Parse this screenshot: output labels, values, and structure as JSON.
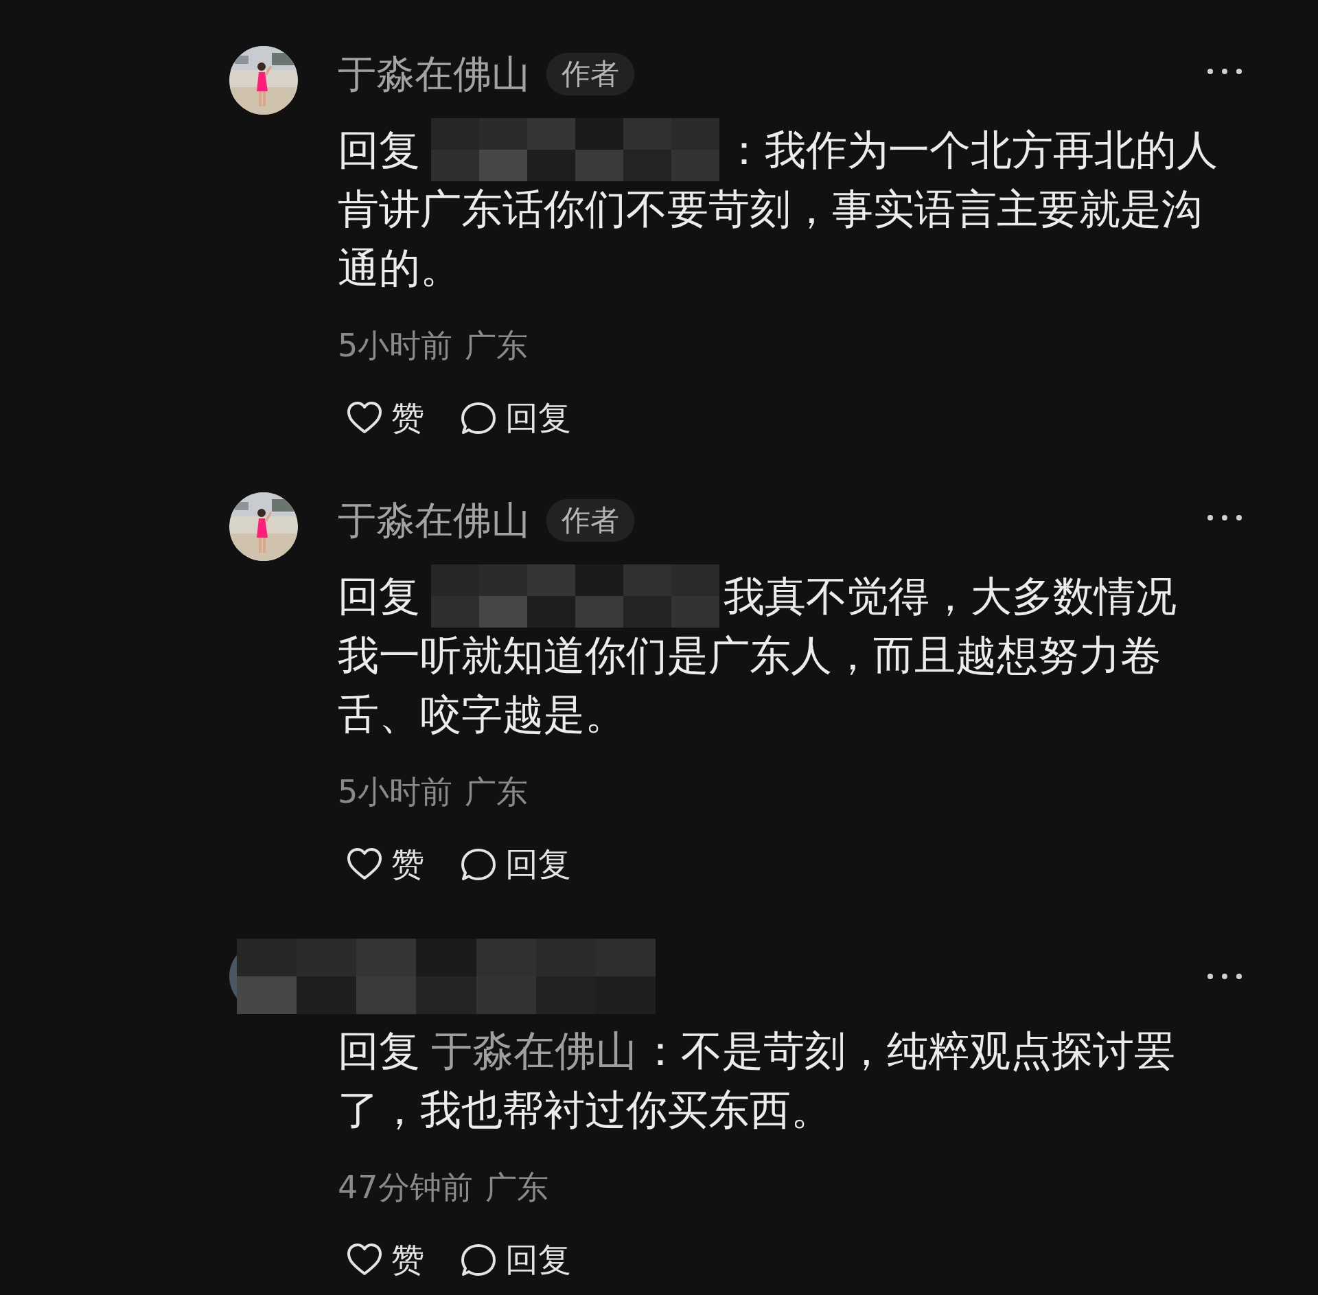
{
  "comments": [
    {
      "author": {
        "kind": "name",
        "name": "于淼在佛山",
        "badge": "作者"
      },
      "reply_label": "回复",
      "reply_to": {
        "kind": "redacted"
      },
      "lines": [
        "：我作为一个北方再北的人",
        "肯讲广东话你们不要苛刻，事实语言主要就是沟",
        "通的。"
      ],
      "time": "5小时前",
      "location": "广东",
      "actions": [
        {
          "kind": "like",
          "label": "赞"
        },
        {
          "kind": "reply",
          "label": "回复"
        }
      ]
    },
    {
      "author": {
        "kind": "name",
        "name": "于淼在佛山",
        "badge": "作者"
      },
      "reply_label": "回复",
      "reply_to": {
        "kind": "redacted"
      },
      "lines": [
        "我真不觉得，大多数情况",
        "我一听就知道你们是广东人，而且越想努力卷",
        "舌、咬字越是。"
      ],
      "time": "5小时前",
      "location": "广东",
      "actions": [
        {
          "kind": "like",
          "label": "赞"
        },
        {
          "kind": "reply",
          "label": "回复"
        }
      ]
    },
    {
      "author": {
        "kind": "redacted"
      },
      "reply_label": "回复",
      "reply_to": {
        "kind": "name",
        "name": "于淼在佛山"
      },
      "lines": [
        "：不是苛刻，纯粹观点探讨罢",
        "了，我也帮衬过你买东西。"
      ],
      "time": "47分钟前",
      "location": "广东",
      "actions": [
        {
          "kind": "like",
          "label": "赞"
        },
        {
          "kind": "reply",
          "label": "回复"
        }
      ]
    }
  ]
}
